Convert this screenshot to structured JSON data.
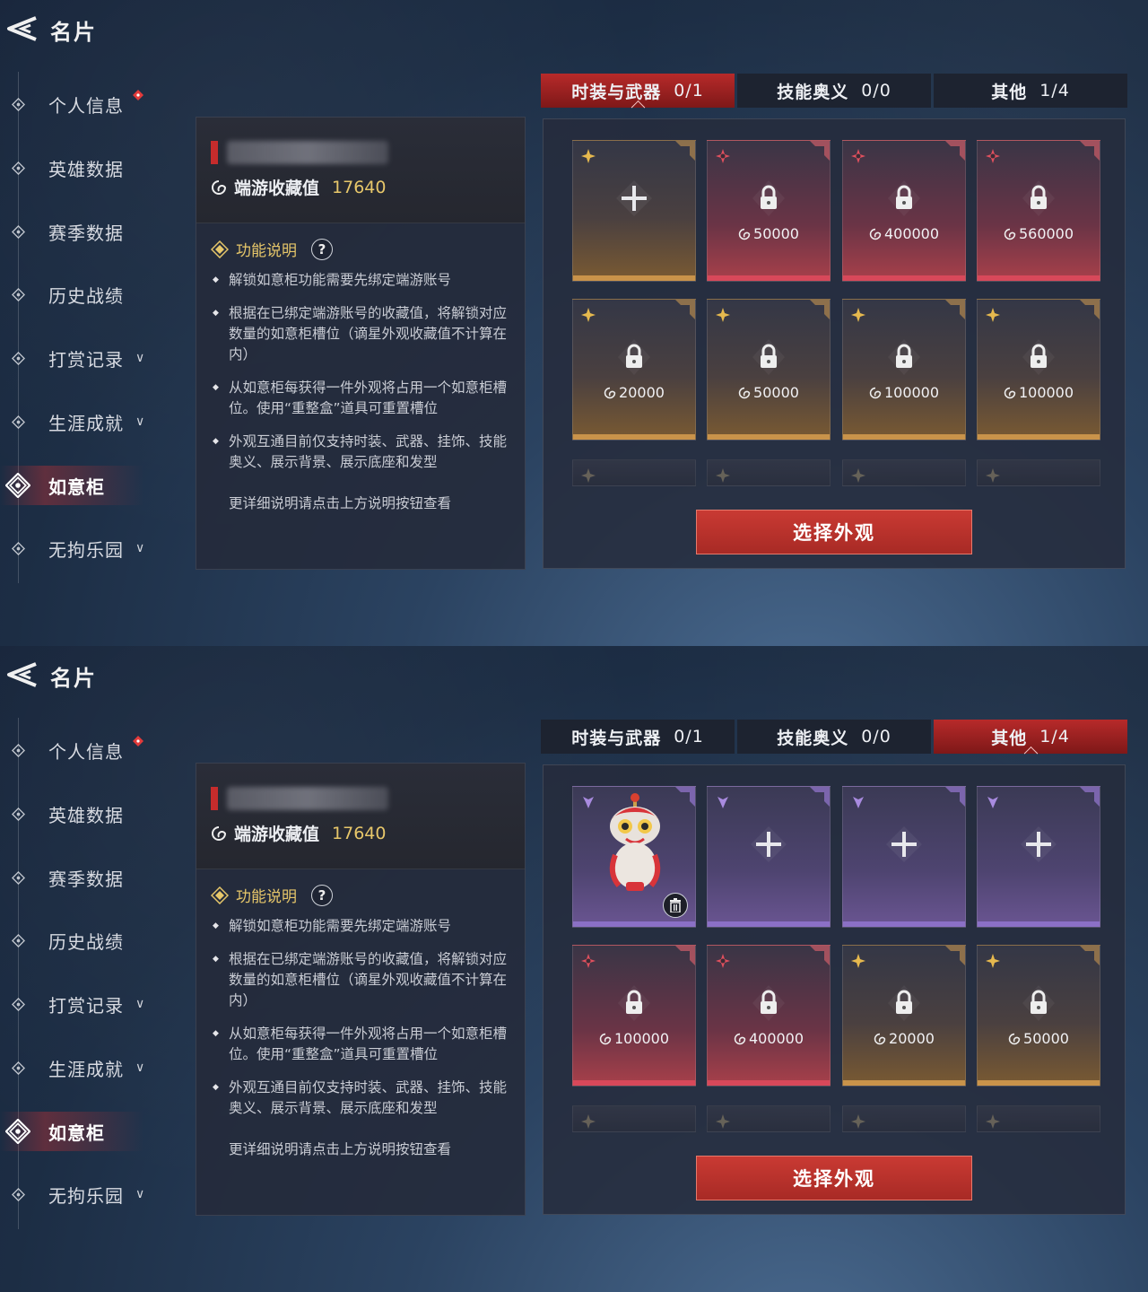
{
  "screens": [
    {
      "header": {
        "title": "名片"
      },
      "sidebar": {
        "items": [
          {
            "label": "个人信息"
          },
          {
            "label": "英雄数据"
          },
          {
            "label": "赛季数据"
          },
          {
            "label": "历史战绩"
          },
          {
            "label": "打赏记录"
          },
          {
            "label": "生涯成就"
          },
          {
            "label": "如意柜"
          },
          {
            "label": "无拘乐园"
          }
        ]
      },
      "info": {
        "collection_label": "端游收藏值",
        "collection_value": "17640",
        "func_label": "功能说明",
        "help": "?",
        "bullets": [
          "解锁如意柜功能需要先绑定端游账号",
          "根据在已绑定端游账号的收藏值，将解锁对应数量的如意柜槽位（谪星外观收藏值不计算在内）",
          "从如意柜每获得一件外观将占用一个如意柜槽位。使用“重整盒”道具可重置槽位",
          "外观互通目前仅支持时装、武器、挂饰、技能奥义、展示背景、展示底座和发型"
        ],
        "more": "更详细说明请点击上方说明按钮查看"
      },
      "tabs": [
        {
          "label": "时装与武器",
          "value": "0/1"
        },
        {
          "label": "技能奥义",
          "value": "0/0"
        },
        {
          "label": "其他",
          "value": "1/4"
        }
      ],
      "slots": [
        "",
        "50000",
        "400000",
        "560000",
        "20000",
        "50000",
        "100000",
        "100000"
      ],
      "select_button": "选择外观"
    },
    {
      "header": {
        "title": "名片"
      },
      "sidebar": {
        "items": [
          {
            "label": "个人信息"
          },
          {
            "label": "英雄数据"
          },
          {
            "label": "赛季数据"
          },
          {
            "label": "历史战绩"
          },
          {
            "label": "打赏记录"
          },
          {
            "label": "生涯成就"
          },
          {
            "label": "如意柜"
          },
          {
            "label": "无拘乐园"
          }
        ]
      },
      "info": {
        "collection_label": "端游收藏值",
        "collection_value": "17640",
        "func_label": "功能说明",
        "help": "?",
        "bullets": [
          "解锁如意柜功能需要先绑定端游账号",
          "根据在已绑定端游账号的收藏值，将解锁对应数量的如意柜槽位（谪星外观收藏值不计算在内）",
          "从如意柜每获得一件外观将占用一个如意柜槽位。使用“重整盒”道具可重置槽位",
          "外观互通目前仅支持时装、武器、挂饰、技能奥义、展示背景、展示底座和发型"
        ],
        "more": "更详细说明请点击上方说明按钮查看"
      },
      "tabs": [
        {
          "label": "时装与武器",
          "value": "0/1"
        },
        {
          "label": "技能奥义",
          "value": "0/0"
        },
        {
          "label": "其他",
          "value": "1/4"
        }
      ],
      "slots": [
        "",
        "",
        "",
        "",
        "100000",
        "400000",
        "20000",
        "50000"
      ],
      "select_button": "选择外观"
    }
  ],
  "colors": {
    "accent_red": "#c62c2c",
    "gold_text": "#e7c76a",
    "rarity_gold": "#c9934a",
    "rarity_red": "#d8485a",
    "rarity_purple": "#8b70c6"
  },
  "icons": {
    "back": "back-arrow-icon",
    "nav": "diamond-icon",
    "collection": "swirl-icon",
    "locked": "lock-icon",
    "empty": "plus-icon",
    "delete": "trash-icon",
    "help": "question-icon"
  }
}
